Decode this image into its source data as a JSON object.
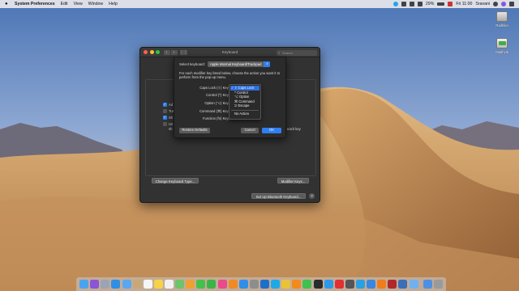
{
  "menubar": {
    "app_name": "System Preferences",
    "items": [
      "Edit",
      "View",
      "Window",
      "Help"
    ],
    "battery": "29%",
    "clock": "Fri 11:00",
    "user": "Sravani"
  },
  "desktop_icons": [
    {
      "label": "Radhika",
      "icon": "hard-drive-icon"
    },
    {
      "label": "Madhvik",
      "icon": "external-drive-icon"
    }
  ],
  "prefs_window": {
    "title": "Keyboard",
    "search_placeholder": "Search",
    "truncated_labels": [
      "Ad",
      "Tur",
      "Sh",
      "Us",
      "sh",
      "each key"
    ],
    "buttons": {
      "change_keyboard_type": "Change Keyboard Type...",
      "modifier_keys": "Modifier Keys...",
      "setup_bluetooth": "Set Up Bluetooth Keyboard...",
      "help": "?"
    }
  },
  "sheet": {
    "select_label": "Select keyboard:",
    "selected_keyboard": "Apple Internal Keyboard/Trackpad",
    "instructions": "For each modifier key listed below, choose the action you want it to perform from the pop-up menu.",
    "rows": [
      {
        "label": "Caps Lock (⇪) Key:",
        "value": "⇪ Caps Lock"
      },
      {
        "label": "Control (^) Key:",
        "value": "^ Control"
      },
      {
        "label": "Option (⌥) Key:",
        "value": "⌥ Option"
      },
      {
        "label": "Command (⌘) Key:",
        "value": "⌘ Command"
      },
      {
        "label": "Function (fn) Key:",
        "value": "fn Function"
      }
    ],
    "restore_defaults": "Restore Defaults",
    "cancel": "Cancel",
    "ok": "OK"
  },
  "dropdown": {
    "items": [
      {
        "label": "⇪ Caps Lock",
        "selected": true
      },
      {
        "label": "^ Control",
        "selected": false
      },
      {
        "label": "⌥ Option",
        "selected": false
      },
      {
        "label": "⌘ Command",
        "selected": false
      },
      {
        "label": "⎋ Escape",
        "selected": false
      }
    ],
    "no_action": "No Action"
  },
  "dock": {
    "apps": [
      {
        "name": "finder-icon",
        "color": "#4aa3f0"
      },
      {
        "name": "siri-icon",
        "color": "#8a55d8"
      },
      {
        "name": "launchpad-icon",
        "color": "#9aa4b3"
      },
      {
        "name": "safari-icon",
        "color": "#2f8fe6"
      },
      {
        "name": "mail-icon",
        "color": "#5aa7f0"
      },
      {
        "name": "contacts-icon",
        "color": "#c8a878"
      },
      {
        "name": "calendar-icon",
        "color": "#f5f5f5"
      },
      {
        "name": "notes-icon",
        "color": "#f6d24a"
      },
      {
        "name": "reminders-icon",
        "color": "#f1f1f1"
      },
      {
        "name": "maps-icon",
        "color": "#6fc36a"
      },
      {
        "name": "photos-icon",
        "color": "#f0a030"
      },
      {
        "name": "messages-icon",
        "color": "#45c04b"
      },
      {
        "name": "facetime-icon",
        "color": "#3bb54a"
      },
      {
        "name": "itunes-icon",
        "color": "#e84a8a"
      },
      {
        "name": "ibooks-icon",
        "color": "#f08a24"
      },
      {
        "name": "app-store-icon",
        "color": "#2f8fe6"
      },
      {
        "name": "system-preferences-icon",
        "color": "#8d8d8d"
      },
      {
        "name": "outlook-icon",
        "color": "#1e6fc8"
      },
      {
        "name": "skype-icon",
        "color": "#1fa8e8"
      },
      {
        "name": "chrome-icon",
        "color": "#e8c33a"
      },
      {
        "name": "vlc-icon",
        "color": "#f28a1c"
      },
      {
        "name": "whatsapp-icon",
        "color": "#3ec14f"
      },
      {
        "name": "terminal-icon",
        "color": "#2b2b2b"
      },
      {
        "name": "twitter-icon",
        "color": "#2b9ae8"
      },
      {
        "name": "youtube-icon",
        "color": "#e03030"
      },
      {
        "name": "camera-icon",
        "color": "#555555"
      },
      {
        "name": "telegram-icon",
        "color": "#2aa0e0"
      },
      {
        "name": "airmail-icon",
        "color": "#3a86e0"
      },
      {
        "name": "vlc-2-icon",
        "color": "#f07d1a"
      },
      {
        "name": "photo-booth-icon",
        "color": "#b02828"
      },
      {
        "name": "screen-sharing-icon",
        "color": "#3a6fb8"
      },
      {
        "name": "folder-icon",
        "color": "#6fb1f0"
      },
      {
        "name": "downloads-icon",
        "color": "#4e8fe0"
      },
      {
        "name": "trash-icon",
        "color": "#9a9a9a"
      }
    ]
  }
}
